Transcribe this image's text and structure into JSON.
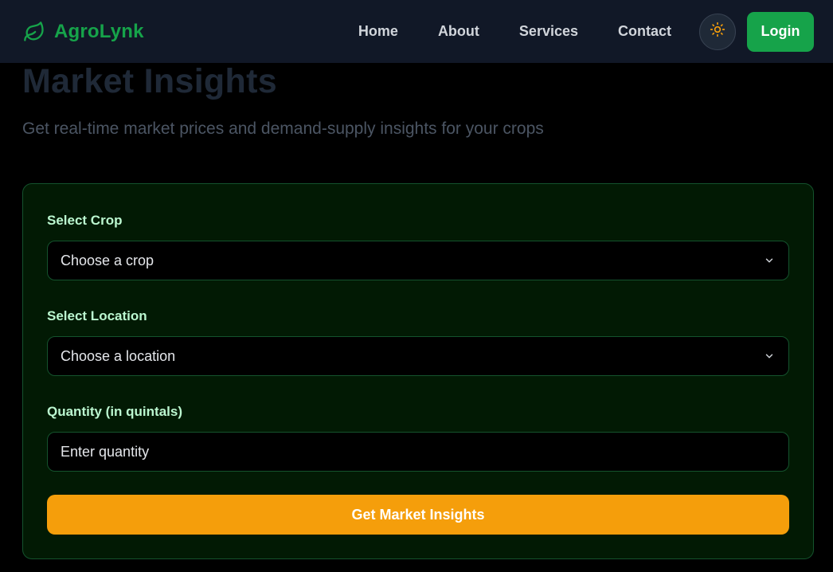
{
  "header": {
    "brand_name": "AgroLynk",
    "nav": [
      {
        "label": "Home"
      },
      {
        "label": "About"
      },
      {
        "label": "Services"
      },
      {
        "label": "Contact"
      }
    ],
    "login_label": "Login"
  },
  "hero": {
    "title": "Market Insights",
    "subtitle": "Get real-time market prices and demand-supply insights for your crops"
  },
  "form": {
    "crop": {
      "label": "Select Crop",
      "value": "Choose a crop"
    },
    "location": {
      "label": "Select Location",
      "value": "Choose a location"
    },
    "quantity": {
      "label": "Quantity (in quintals)",
      "placeholder": "Enter quantity"
    },
    "submit_label": "Get Market Insights"
  },
  "icons": {
    "brand": "leaf-icon",
    "theme": "sun-icon",
    "select_arrow": "chevron-down-icon"
  },
  "colors": {
    "brand_green": "#16a34a",
    "accent_orange": "#f59e0b",
    "navbar_bg": "#111827",
    "card_bg": "#021a04",
    "label_green": "#bbf7d0"
  }
}
